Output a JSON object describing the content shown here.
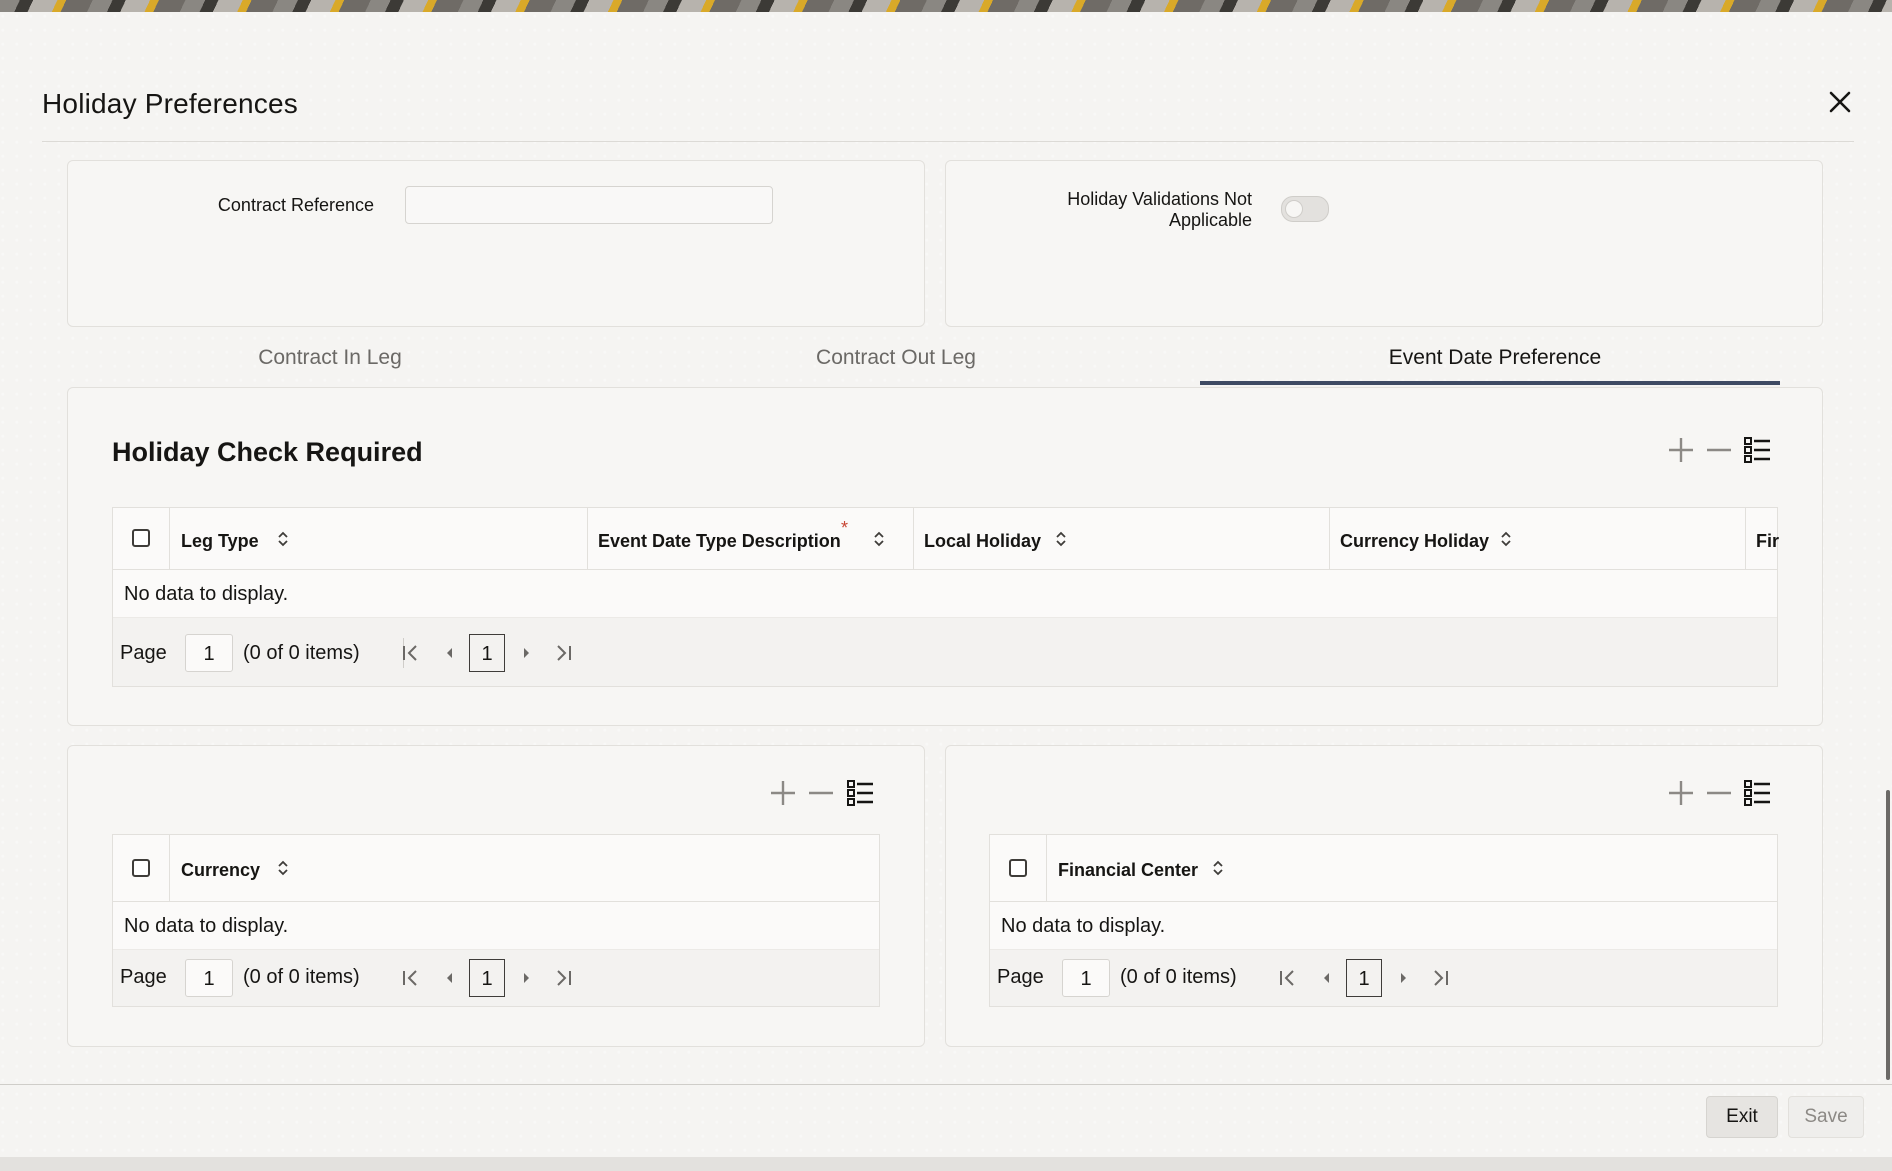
{
  "dialog": {
    "title": "Holiday Preferences",
    "close_icon": "close-icon"
  },
  "header_fields": {
    "contract_reference_label": "Contract Reference",
    "contract_reference_value": "",
    "holiday_validations_label_line1": "Holiday Validations Not",
    "holiday_validations_label_line2": "Applicable",
    "holiday_validations_on": false
  },
  "tabs": [
    {
      "label": "Contract In Leg",
      "active": false
    },
    {
      "label": "Contract Out Leg",
      "active": false
    },
    {
      "label": "Event Date Preference",
      "active": true
    }
  ],
  "holiday_check": {
    "title": "Holiday Check Required",
    "columns": [
      "Leg Type",
      "Event Date Type Description",
      "Local Holiday",
      "Currency Holiday",
      "Fir"
    ],
    "required_marker": "*",
    "empty_text": "No data to display.",
    "pager": {
      "page_label": "Page",
      "page_value": "1",
      "items_text": "(0 of 0 items)",
      "current": "1"
    }
  },
  "currency_grid": {
    "columns": [
      "Currency"
    ],
    "empty_text": "No data to display.",
    "pager": {
      "page_label": "Page",
      "page_value": "1",
      "items_text": "(0 of 0 items)",
      "current": "1"
    }
  },
  "financial_center_grid": {
    "columns": [
      "Financial Center"
    ],
    "empty_text": "No data to display.",
    "pager": {
      "page_label": "Page",
      "page_value": "1",
      "items_text": "(0 of 0 items)",
      "current": "1"
    }
  },
  "toolbar_icons": [
    "add-icon",
    "remove-icon",
    "list-view-icon"
  ],
  "footer": {
    "exit_label": "Exit",
    "save_label": "Save"
  },
  "colors": {
    "accent": "#3e4a63",
    "required": "#c74634"
  }
}
